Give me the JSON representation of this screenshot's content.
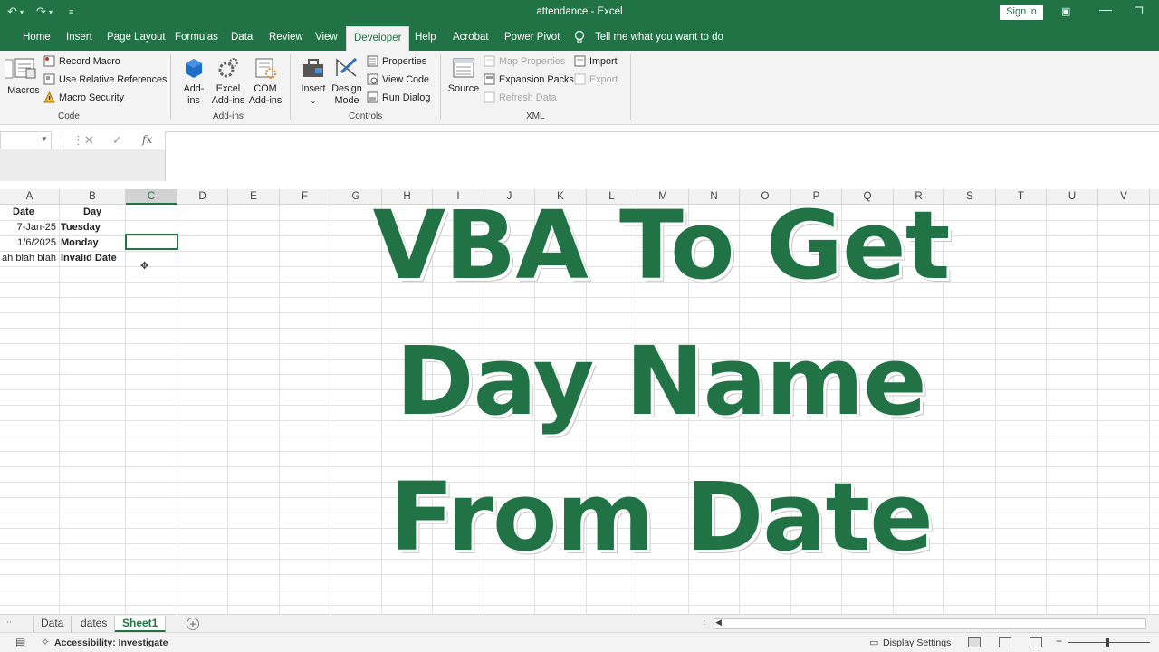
{
  "window": {
    "title": "attendance  -  Excel",
    "sign_in": "Sign in"
  },
  "ribbon_tabs": [
    "Home",
    "Insert",
    "Page Layout",
    "Formulas",
    "Data",
    "Review",
    "View",
    "Developer",
    "Help",
    "Acrobat",
    "Power Pivot"
  ],
  "active_tab": "Developer",
  "tell_me": "Tell me what you want to do",
  "ribbon": {
    "code": {
      "label": "Code",
      "macros": "Macros",
      "record_macro": "Record Macro",
      "use_relative": "Use Relative References",
      "macro_security": "Macro Security"
    },
    "addins": {
      "label": "Add-ins",
      "addins_1": "Add-",
      "addins_2": "ins",
      "excel_addins_1": "Excel",
      "excel_addins_2": "Add-ins",
      "com_addins_1": "COM",
      "com_addins_2": "Add-ins"
    },
    "controls": {
      "label": "Controls",
      "insert": "Insert",
      "design_mode_1": "Design",
      "design_mode_2": "Mode",
      "properties": "Properties",
      "view_code": "View Code",
      "run_dialog": "Run Dialog"
    },
    "xml": {
      "label": "XML",
      "source": "Source",
      "map_properties": "Map Properties",
      "expansion_packs": "Expansion Packs",
      "refresh_data": "Refresh Data",
      "import": "Import",
      "export": "Export"
    }
  },
  "formula_bar": {
    "fx": "fx",
    "cancel": "✕",
    "enter": "✓"
  },
  "columns": [
    "A",
    "B",
    "C",
    "D",
    "E",
    "F",
    "G",
    "H",
    "I",
    "J",
    "K",
    "L",
    "M",
    "N",
    "O",
    "P",
    "Q",
    "R",
    "S",
    "T",
    "U",
    "V"
  ],
  "selected_column": "C",
  "cells": {
    "a1": "Date",
    "b1": "Day",
    "a2": "7-Jan-25",
    "b2": "Tuesday",
    "a3": "1/6/2025",
    "b3": "Monday",
    "a4": "ah blah blah",
    "b4": "Invalid Date"
  },
  "headline": {
    "line1": "VBA To Get",
    "line2": "Day Name",
    "line3": "From Date",
    "color": "#217346"
  },
  "sheets": [
    "Data",
    "dates",
    "Sheet1"
  ],
  "active_sheet": "Sheet1",
  "status": {
    "accessibility": "Accessibility: Investigate",
    "display_settings": "Display Settings"
  },
  "colors": {
    "excel_green": "#217346",
    "ribbon_bg": "#f3f3f3"
  }
}
